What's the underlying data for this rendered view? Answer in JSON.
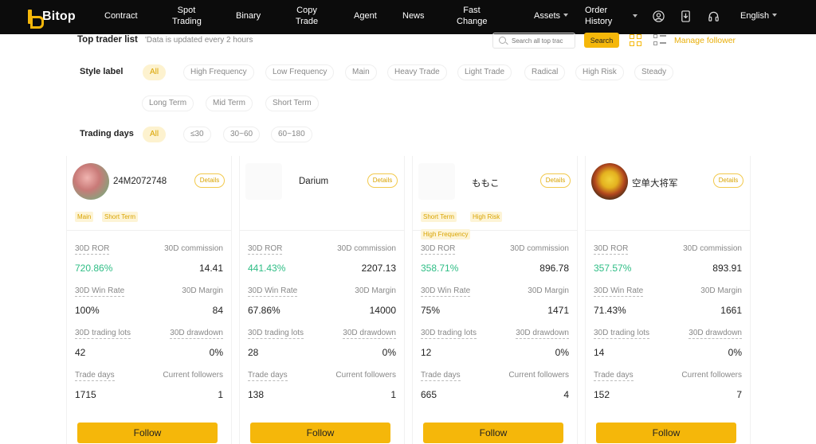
{
  "nav": {
    "logo": "Bitop",
    "items": [
      {
        "label": "Contract"
      },
      {
        "label": "Spot\nTrading"
      },
      {
        "label": "Binary"
      },
      {
        "label": "Copy\nTrade"
      },
      {
        "label": "Agent"
      },
      {
        "label": "News"
      },
      {
        "label": "Fast\nChange"
      },
      {
        "label": "Assets"
      },
      {
        "label": "Order\nHistory"
      }
    ],
    "language": "English",
    "icons": [
      "user-icon",
      "download-icon",
      "headset-icon"
    ]
  },
  "toolbar": {
    "title": "Top trader list",
    "note": "'Data is updated every 2 hours",
    "search_placeholder": "Search all top trac",
    "search_button": "Search",
    "manage_follower": "Manage follower"
  },
  "filters": {
    "style_label": "Style label",
    "style_chips": [
      "All",
      "High Frequency",
      "Low Frequency",
      "Main",
      "Heavy Trade",
      "Light Trade",
      "Radical",
      "High Risk",
      "Steady",
      "Long Term",
      "Mid Term",
      "Short Term"
    ],
    "style_selected": "All",
    "days_label": "Trading days",
    "day_chips": [
      "All",
      "≤30",
      "30~60",
      "60~180"
    ],
    "days_selected": "All"
  },
  "stat_labels": {
    "ror": "30D ROR",
    "commission": "30D commission",
    "win_rate": "30D Win Rate",
    "margin": "30D Margin",
    "lots": "30D trading lots",
    "drawdown": "30D drawdown",
    "trade_days": "Trade days",
    "followers": "Current followers"
  },
  "details_label": "Details",
  "follow_label": "Follow",
  "traders": [
    {
      "name": "24M2072748",
      "avatar": "pink",
      "tags": [
        "Main",
        "Short Term"
      ],
      "ror": "720.86%",
      "commission": "14.41",
      "win_rate": "100%",
      "margin": "84",
      "lots": "42",
      "drawdown": "0%",
      "trade_days": "1715",
      "followers": "1"
    },
    {
      "name": "Darium",
      "avatar": "blank",
      "tags": [],
      "ror": "441.43%",
      "commission": "2207.13",
      "win_rate": "67.86%",
      "margin": "14000",
      "lots": "28",
      "drawdown": "0%",
      "trade_days": "138",
      "followers": "1"
    },
    {
      "name": "ももこ",
      "avatar": "blank",
      "tags": [
        "Short Term",
        "High Risk",
        "High Frequency"
      ],
      "ror": "358.71%",
      "commission": "896.78",
      "win_rate": "75%",
      "margin": "1471",
      "lots": "12",
      "drawdown": "0%",
      "trade_days": "665",
      "followers": "4"
    },
    {
      "name": "空单大将军",
      "avatar": "fruit",
      "tags": [],
      "ror": "357.57%",
      "commission": "893.91",
      "win_rate": "71.43%",
      "margin": "1661",
      "lots": "14",
      "drawdown": "0%",
      "trade_days": "152",
      "followers": "7"
    }
  ],
  "colors": {
    "accent": "#f5b70a",
    "positive": "#2ebd85",
    "nav_bg": "#0c0c0c"
  }
}
